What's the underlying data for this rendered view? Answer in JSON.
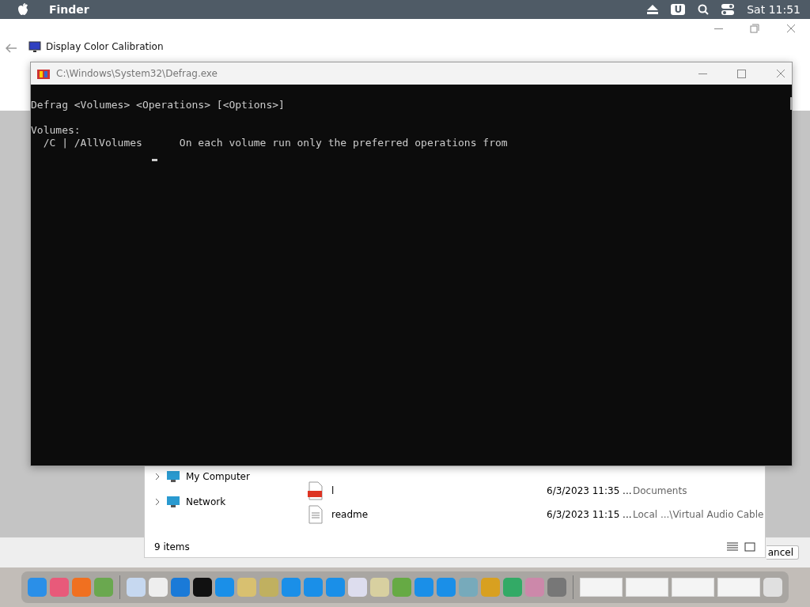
{
  "menu_bar": {
    "app_name": "Finder",
    "clock": "Sat 11:51",
    "input_badge": "U"
  },
  "calibration_window": {
    "title": "Display Color Calibration"
  },
  "console_window": {
    "title": "C:\\Windows\\System32\\Defrag.exe",
    "usage": "Defrag <Volumes> <Operations> [<Options>]",
    "lines": [
      "Volumes:",
      "  /C | /AllVolumes      On each volume run only the preferred operations from"
    ]
  },
  "file_dialog": {
    "tree": [
      {
        "label": "My Computer",
        "expanded": false
      },
      {
        "label": "Network",
        "expanded": false
      }
    ],
    "files": [
      {
        "name": "l",
        "kind": "pdf",
        "modified": "6/3/2023 11:35 ...",
        "location": "Documents"
      },
      {
        "name": "readme",
        "kind": "text",
        "modified": "6/3/2023 11:15 ...",
        "location": "Local ...\\Virtual Audio Cable"
      }
    ],
    "status": "9 items"
  },
  "wizard_buttons": {
    "cancel": "ancel"
  }
}
